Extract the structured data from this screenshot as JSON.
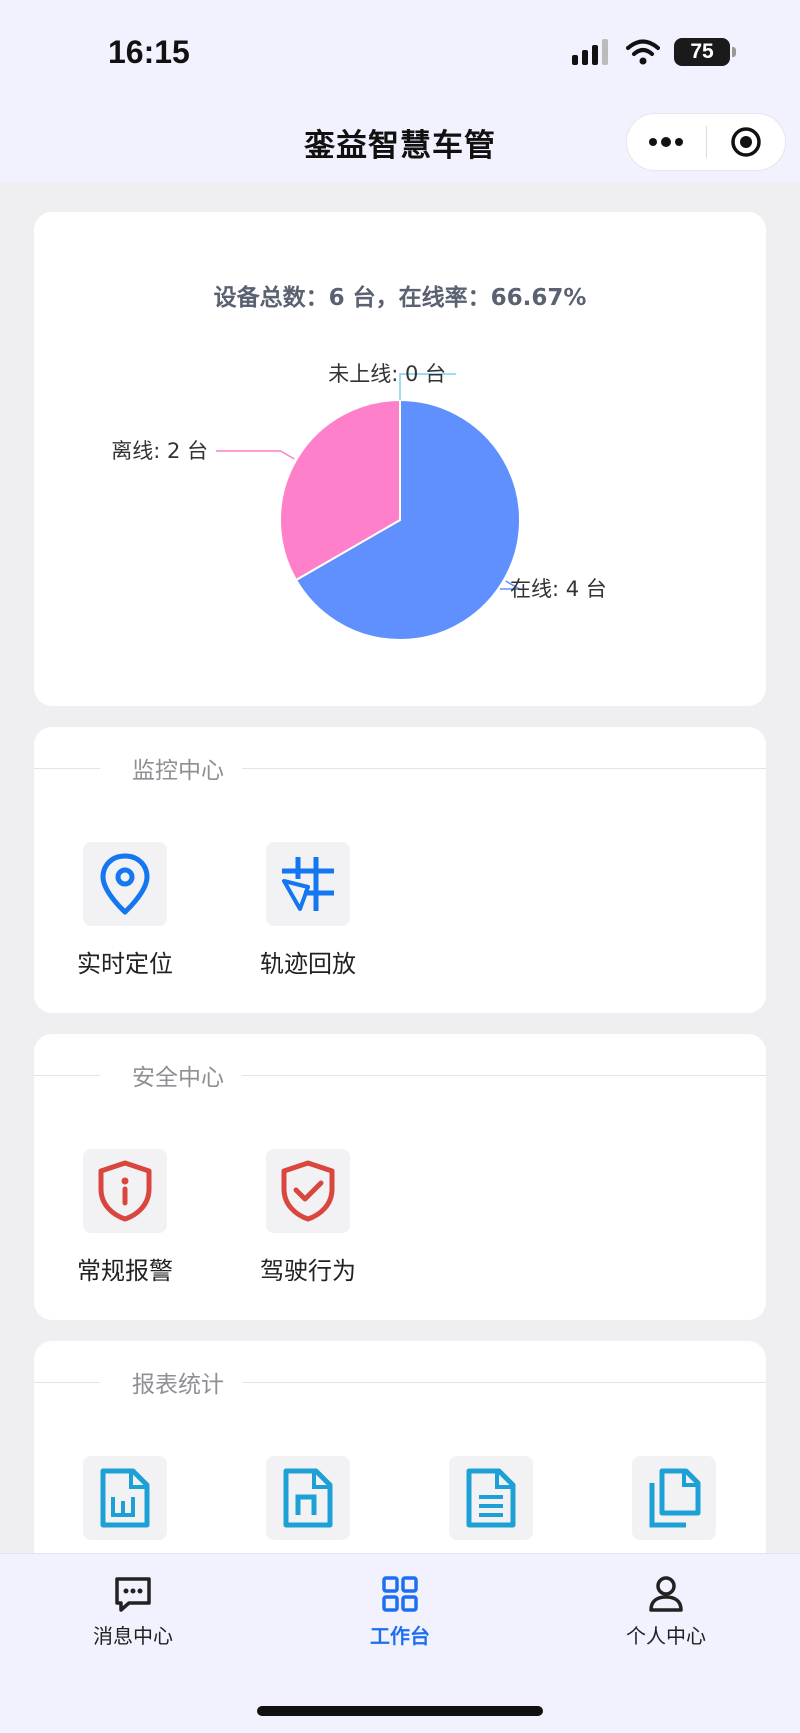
{
  "status_bar": {
    "time": "16:15",
    "battery": "75"
  },
  "header": {
    "title": "銮益智慧车管"
  },
  "device_card": {
    "summary": "设备总数：6 台，在线率：66.67%"
  },
  "chart_data": {
    "type": "pie",
    "title": "设备总数：6 台，在线率：66.67%",
    "slices": [
      {
        "label": "在线: 4 台",
        "value": 4,
        "color": "#6090fd"
      },
      {
        "label": "离线: 2 台",
        "value": 2,
        "color": "#fe7fca"
      },
      {
        "label": "未上线: 0 台",
        "value": 0,
        "color": "#7fd0ef"
      }
    ]
  },
  "monitor": {
    "title": "监控中心",
    "items": [
      {
        "label": "实时定位",
        "icon": "location-pin-icon"
      },
      {
        "label": "轨迹回放",
        "icon": "track-playback-icon"
      }
    ]
  },
  "safety": {
    "title": "安全中心",
    "items": [
      {
        "label": "常规报警",
        "icon": "alarm-shield-icon"
      },
      {
        "label": "驾驶行为",
        "icon": "check-shield-icon"
      }
    ]
  },
  "reports": {
    "title": "报表统计",
    "items": [
      {
        "icon": "word-doc-icon"
      },
      {
        "icon": "n-doc-icon"
      },
      {
        "icon": "text-doc-icon"
      },
      {
        "icon": "copy-doc-icon"
      }
    ]
  },
  "nav": {
    "items": [
      {
        "label": "消息中心",
        "icon": "message-icon"
      },
      {
        "label": "工作台",
        "icon": "grid-icon",
        "active": true
      },
      {
        "label": "个人中心",
        "icon": "person-icon"
      }
    ]
  },
  "colors": {
    "accent": "#1e6ff0",
    "icon_blue": "#1476f0",
    "icon_red": "#d9463e",
    "icon_cyan": "#1da0d6"
  }
}
